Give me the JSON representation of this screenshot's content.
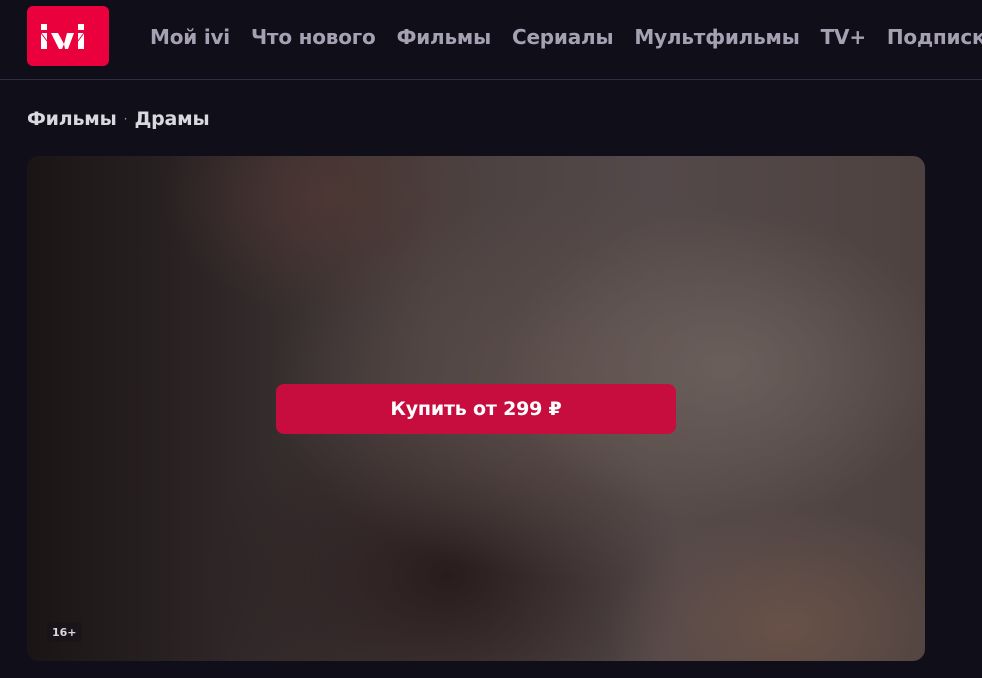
{
  "header": {
    "logo_text": "ivi",
    "brand_color": "#ea003d",
    "nav": [
      "Мой ivi",
      "Что нового",
      "Фильмы",
      "Сериалы",
      "Мультфильмы",
      "TV+",
      "Подписка"
    ]
  },
  "breadcrumb": {
    "items": [
      "Фильмы",
      "Драмы"
    ],
    "separator": "·"
  },
  "player": {
    "buy_label": "Купить от 299 ₽",
    "age_rating": "16+",
    "button_color": "#c70d3e"
  }
}
